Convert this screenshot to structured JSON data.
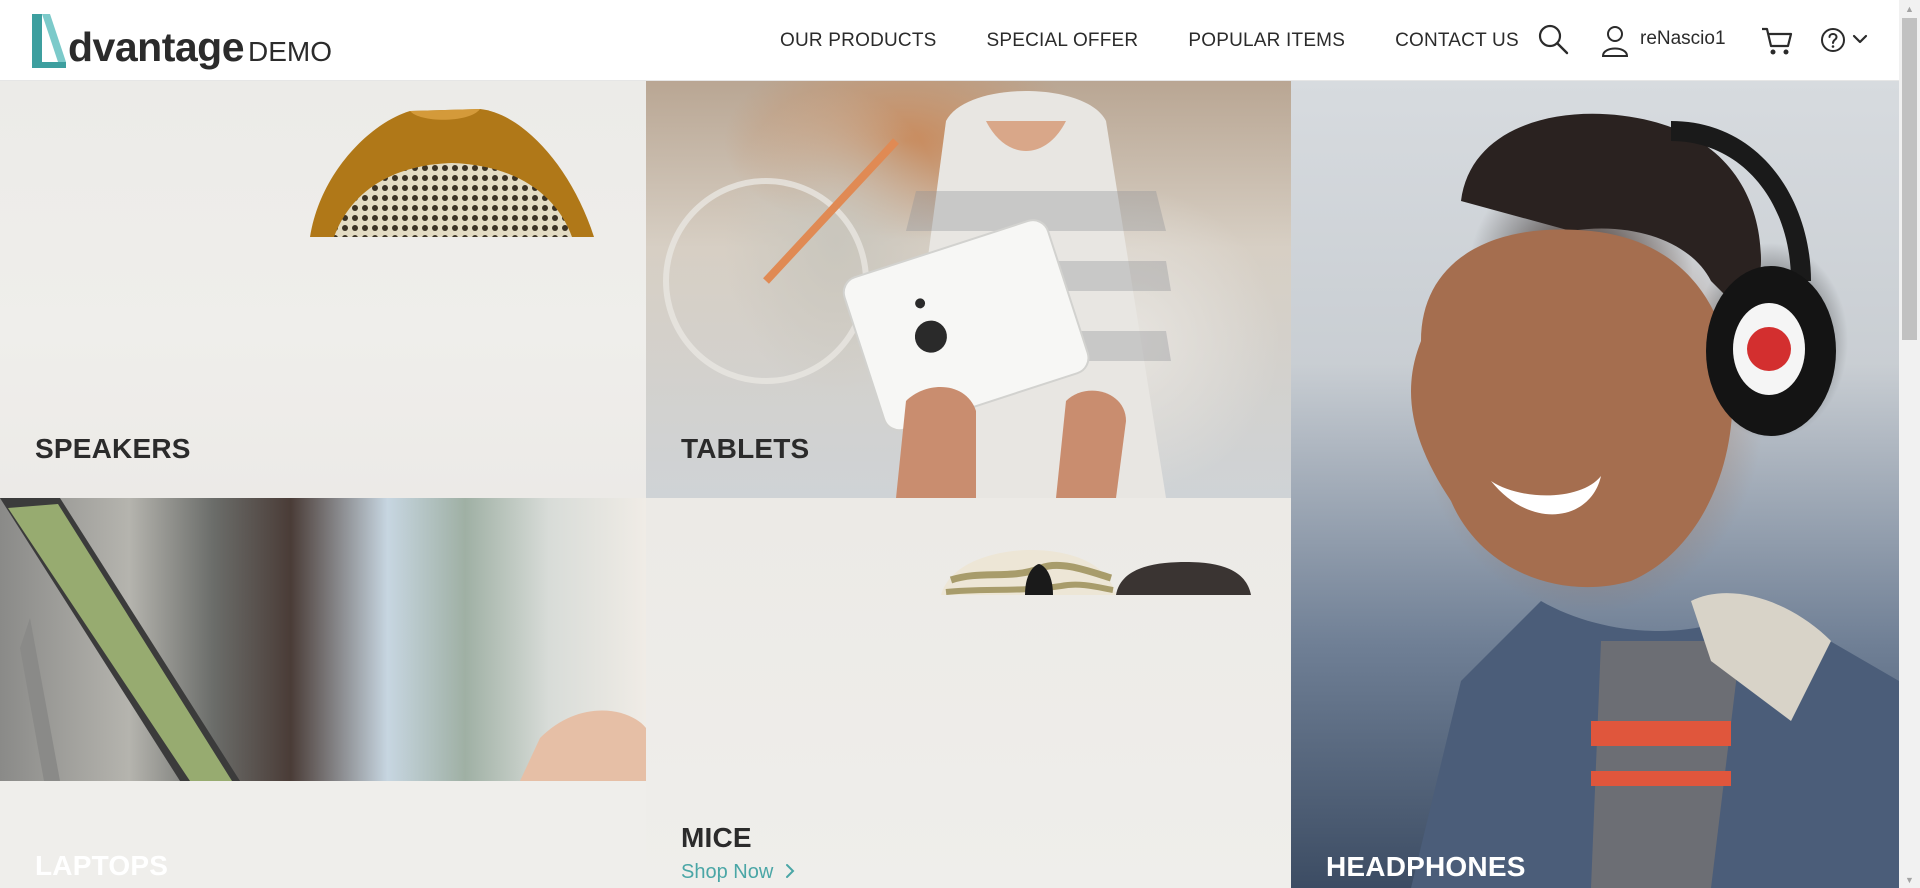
{
  "logo": {
    "word": "dvantage",
    "demo": "DEMO"
  },
  "nav": {
    "items": [
      "OUR PRODUCTS",
      "SPECIAL OFFER",
      "POPULAR ITEMS",
      "CONTACT US"
    ]
  },
  "user": {
    "name": "reNascio1"
  },
  "icons": {
    "search": "search-icon",
    "user": "user-icon",
    "cart": "cart-icon",
    "help": "help-icon",
    "help_dropdown": "chevron-down-icon"
  },
  "categories": {
    "speakers": "SPEAKERS",
    "tablets": "TABLETS",
    "laptops": "LAPTOPS",
    "mice": "MICE",
    "headphones": "HEADPHONES"
  },
  "mice_link": "Shop Now",
  "colors": {
    "accent": "#4aa6a6",
    "text": "#2b2b2b"
  }
}
